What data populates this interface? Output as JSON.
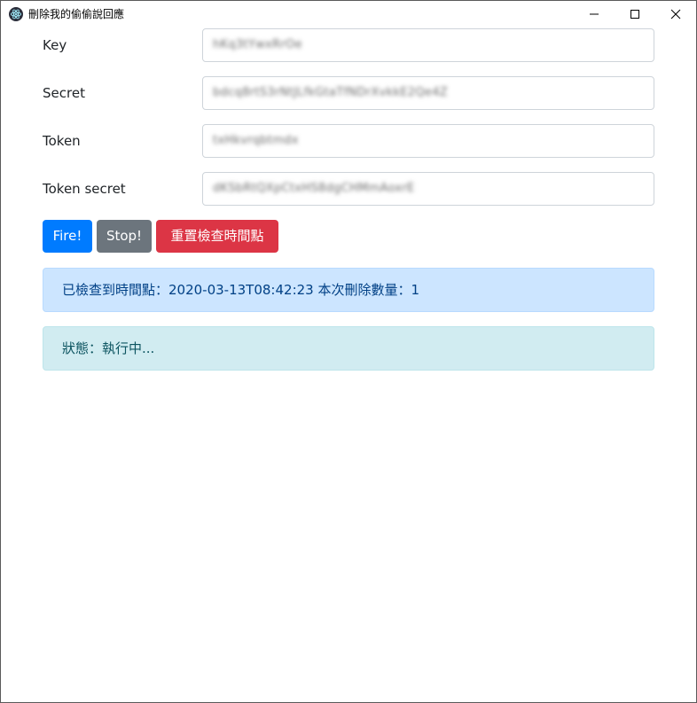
{
  "window": {
    "title": "刪除我的偷偷說回應",
    "icon": "electron-app-icon",
    "controls": [
      "minimize-icon",
      "maximize-icon",
      "close-icon"
    ]
  },
  "form": {
    "fields": [
      {
        "label": "Key",
        "value": "hKq3tYwxRrOe"
      },
      {
        "label": "Secret",
        "value": "bdcq8rtS3rNtJLfkGtaTfNDrXvkkE2Qe4Z"
      },
      {
        "label": "Token",
        "value": "txHkvrqbtmdx"
      },
      {
        "label": "Token secret",
        "value": "dKSbRtQXpCtxHS8dgCHMmAoxrE"
      }
    ]
  },
  "buttons": {
    "fire": "Fire!",
    "stop": "Stop!",
    "reset": "重置檢查時間點"
  },
  "alerts": {
    "checked": "已檢查到時間點：2020-03-13T08:42:23 本次刪除數量：1",
    "status": "狀態：執行中..."
  },
  "colors": {
    "primary": "#007bff",
    "secondary": "#6c757d",
    "danger": "#dc3545",
    "alert_primary_bg": "#cce5ff",
    "alert_info_bg": "#d1ecf1"
  }
}
